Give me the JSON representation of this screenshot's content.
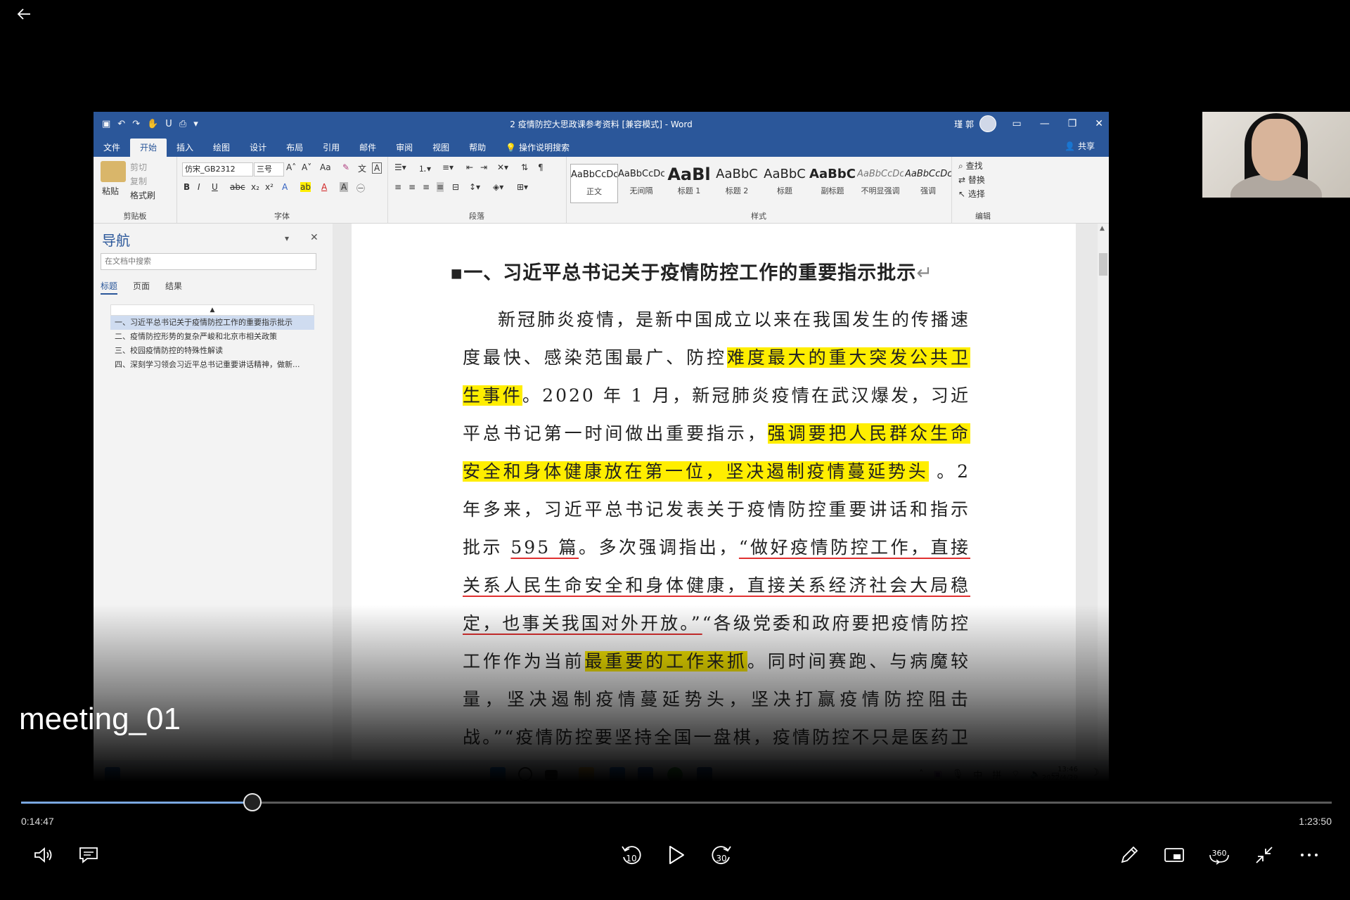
{
  "player": {
    "title_overlay": "meeting_01",
    "time_current": "0:14:47",
    "time_total": "1:23:50",
    "progress": 0.1764,
    "icons": [
      "back-arrow-icon",
      "volume-icon",
      "captions-icon",
      "rewind-10-icon",
      "play-icon",
      "forward-30-icon",
      "pen-icon",
      "miniplayer-icon",
      "360-icon",
      "exit-fullscreen-icon",
      "more-icon"
    ],
    "rewind_label": "10",
    "forward_label": "30",
    "vr_label": "360"
  },
  "word": {
    "window_title": "2 疫情防控大思政课参考资料 [兼容模式] - Word",
    "user_name": "瑾 郭",
    "share_label": "共享",
    "menu_tabs": [
      "文件",
      "开始",
      "插入",
      "绘图",
      "设计",
      "布局",
      "引用",
      "邮件",
      "审阅",
      "视图",
      "帮助",
      "操作说明搜索"
    ],
    "ribbon": {
      "clipboard": {
        "paste": "粘贴",
        "cut": "剪切",
        "copy": "复制",
        "format_painter": "格式刷",
        "label": "剪贴板"
      },
      "font": {
        "name": "仿宋_GB2312",
        "size": "三号",
        "label": "字体"
      },
      "paragraph": {
        "label": "段落"
      },
      "styles": {
        "label": "样式",
        "items": [
          {
            "sample": "AaBbCcDc",
            "name": "正文"
          },
          {
            "sample": "AaBbCcDc",
            "name": "无间隔"
          },
          {
            "sample": "AaBl",
            "name": "标题 1"
          },
          {
            "sample": "AaBbC",
            "name": "标题 2"
          },
          {
            "sample": "AaBbC",
            "name": "标题"
          },
          {
            "sample": "AaBbC",
            "name": "副标题"
          },
          {
            "sample": "AaBbCcDc",
            "name": "不明显强调"
          },
          {
            "sample": "AaBbCcDc",
            "name": "强调"
          }
        ]
      },
      "editing": {
        "find": "查找",
        "replace": "替换",
        "select": "选择",
        "label": "编辑"
      }
    },
    "nav": {
      "title": "导航",
      "search_placeholder": "在文档中搜索",
      "tabs": [
        "标题",
        "页面",
        "结果"
      ],
      "headings": [
        "一、习近平总书记关于疫情防控工作的重要指示批示",
        "二、疫情防控形势的复杂严峻和北京市相关政策",
        "三、校园疫情防控的特殊性解读",
        "四、深刻学习领会习近平总书记重要讲话精神，做新..."
      ]
    },
    "document": {
      "heading": "一、习近平总书记关于疫情防控工作的重要指示批示",
      "p1": "新冠肺炎疫情，是新中国成立以来在我国发生的传播速度最快、感染范围最广、防控",
      "h1": "难度最大的重大突发公共卫生事件",
      "p2": "。2020 年 1 月，新冠肺炎疫情在武汉爆发，习近平总书记第一时间做出重要指示，",
      "h2": "强调要把人民群众生命安全和身体健康放在第一位，坚决遏制疫情蔓延势头",
      "p3": " 。2 年多来，习近平总书记发表关于疫情防控重要讲话和指示批示 ",
      "u1": "595 篇",
      "p4": "。多次强调指出，",
      "u2": "“做好疫情防控工作，直接关系人民生命安全和身体健康，直接关系经济社会大局稳定，也事关我国对外开放。”",
      "p5": "“各级党委和政府要把疫情防控工作作为当前",
      "h3": "最重要的工作来抓",
      "p6": "。同时间赛跑、与病魔较量，坚决遏制疫情蔓延势头，坚决打赢疫情防控阻击战。”“疫情防控要坚持全国一盘棋，疫情防控不只是医药卫生问题，而是全方位的工"
    },
    "taskbar": {
      "tray_ime": "中",
      "tray_pinyin": "拼",
      "clock_time": "13:46",
      "clock_date": "2022/4/29"
    }
  }
}
